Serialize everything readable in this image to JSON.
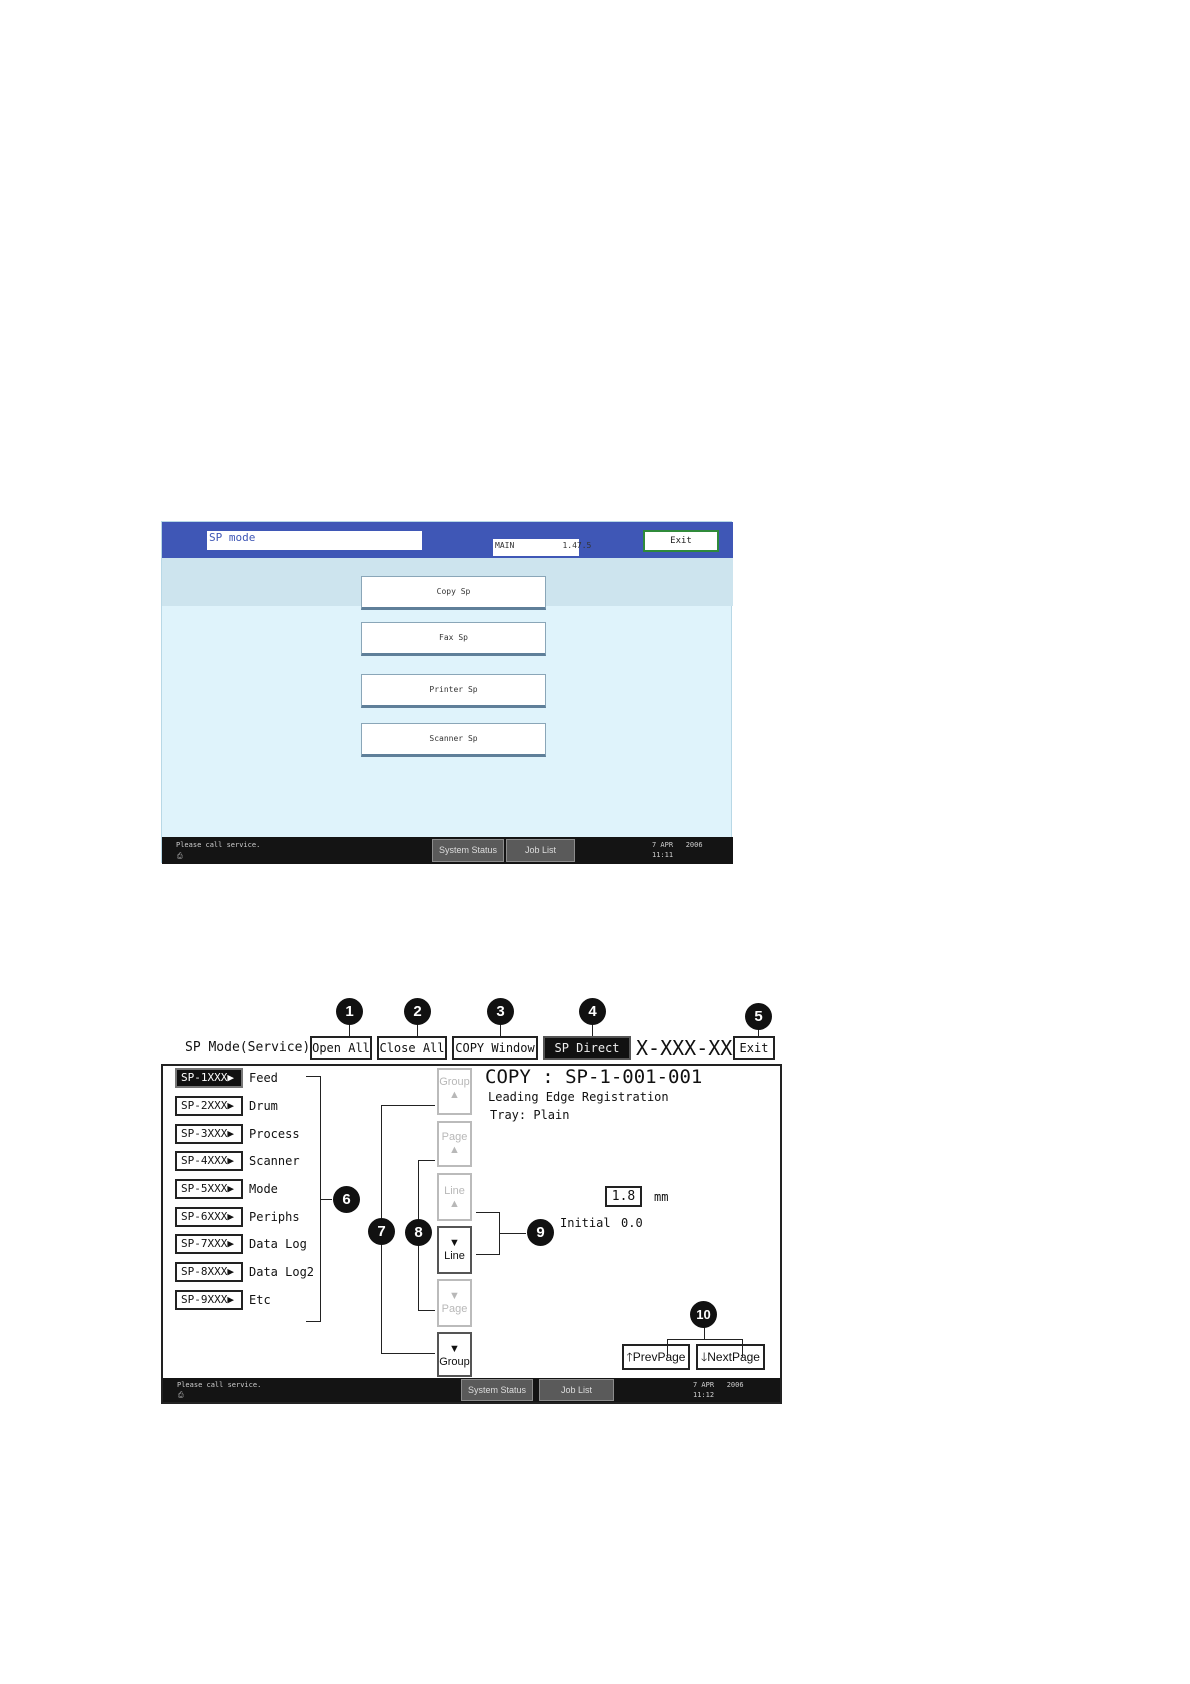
{
  "screen1": {
    "title_field": "SP mode",
    "version_label": "MAIN",
    "version_value": "1.47.5",
    "exit_label": "Exit",
    "menu": [
      "Copy Sp",
      "Fax Sp",
      "Printer Sp",
      "Scanner Sp"
    ],
    "footer": {
      "message": "Please call service.",
      "icon": "printer-icon",
      "system_status": "System Status",
      "job_list": "Job List",
      "date": "7 APR   2006",
      "time": "11:11"
    }
  },
  "screen2": {
    "mode_label": "SP Mode(Service)",
    "open_all": "Open All",
    "close_all": "Close All",
    "copy_window": "COPY Window",
    "sp_direct": "SP Direct",
    "model": "X-XXX-XXX",
    "exit_label": "Exit",
    "sp_groups": [
      {
        "code": "SP-1XXX▶",
        "label": "Feed"
      },
      {
        "code": "SP-2XXX▶",
        "label": "Drum"
      },
      {
        "code": "SP-3XXX▶",
        "label": "Process"
      },
      {
        "code": "SP-4XXX▶",
        "label": "Scanner"
      },
      {
        "code": "SP-5XXX▶",
        "label": "Mode"
      },
      {
        "code": "SP-6XXX▶",
        "label": "Periphs"
      },
      {
        "code": "SP-7XXX▶",
        "label": "Data Log"
      },
      {
        "code": "SP-8XXX▶",
        "label": "Data Log2"
      },
      {
        "code": "SP-9XXX▶",
        "label": "Etc"
      }
    ],
    "nav": {
      "group_up": "Group",
      "page_up": "Page",
      "line_up": "Line",
      "line_down": "Line",
      "page_down": "Page",
      "group_down": "Group"
    },
    "detail": {
      "title": "COPY : SP-1-001-001",
      "name": "Leading Edge Registration",
      "tray": "Tray: Plain",
      "value": "1.8",
      "unit": "mm",
      "initial_label": "Initial",
      "initial_value": "0.0"
    },
    "prev_page": "PrevPage",
    "next_page": "NextPage",
    "footer": {
      "message": "Please call service.",
      "icon": "printer-icon",
      "system_status": "System Status",
      "job_list": "Job List",
      "date": "7 APR   2006",
      "time": "11:12"
    }
  },
  "callouts": [
    "1",
    "2",
    "3",
    "4",
    "5",
    "6",
    "7",
    "8",
    "9",
    "10"
  ]
}
